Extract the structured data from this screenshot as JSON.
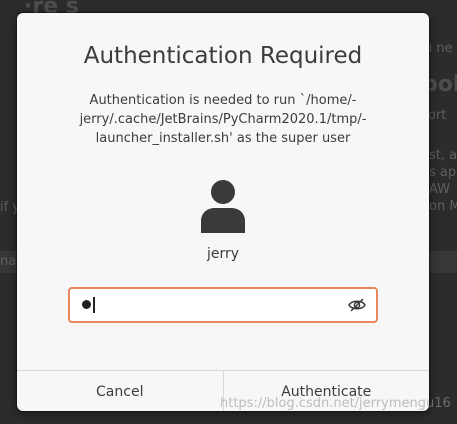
{
  "dialog": {
    "title": "Authentication Required",
    "message": "Authentication is needed to run `/home/-jerry/.cache/JetBrains/PyCharm2020.1/tmp/-launcher_installer.sh' as the super user",
    "username": "jerry",
    "password_value": "●",
    "cancel_label": "Cancel",
    "authenticate_label": "Authenticate"
  },
  "background": {
    "fragments": [
      "u ne",
      "pol",
      "ort",
      "st, a",
      "s app",
      "AW",
      "on M",
      "if y",
      "na"
    ]
  },
  "watermark": "https://blog.csdn.net/jerrymengu16",
  "colors": {
    "dialog_bg": "#f7f7f7",
    "focus_border": "#e9865f",
    "backdrop": "#2c2c2c"
  },
  "icons": {
    "avatar": "avatar-icon",
    "password_visibility": "eye-hidden-icon"
  }
}
